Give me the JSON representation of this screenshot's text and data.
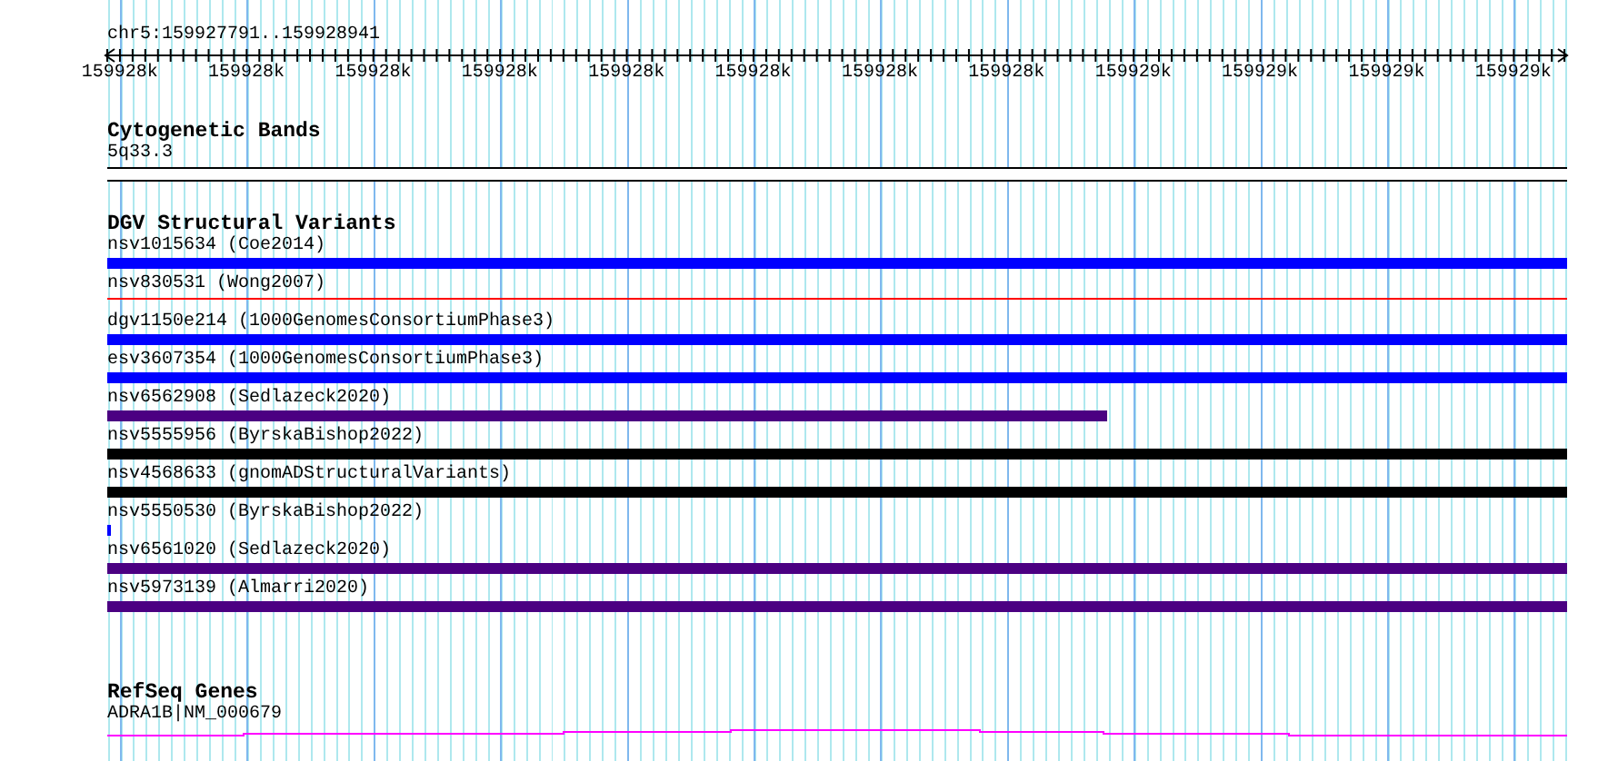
{
  "ruler": {
    "location": "chr5:159927791..159928941",
    "ticks": [
      "159928k",
      "159928k",
      "159928k",
      "159928k",
      "159928k",
      "159928k",
      "159928k",
      "159928k",
      "159929k",
      "159929k",
      "159929k",
      "159929k"
    ]
  },
  "tracks": [
    {
      "kind": "bands",
      "title": "Cytogenetic Bands",
      "features": [
        {
          "label": "5q33.3",
          "level": 1,
          "color": "#ffffff"
        }
      ]
    },
    {
      "kind": "variants",
      "title": "DGV Structural Variants",
      "features": [
        {
          "label": "nsv1015634 (Coe2014)",
          "kind": "bar",
          "level": 1,
          "color": "#0000ff"
        },
        {
          "label": "nsv830531 (Wong2007)",
          "kind": "line",
          "level": 1,
          "color": "#ff0000"
        },
        {
          "label": "dgv1150e214 (1000GenomesConsortiumPhase3)",
          "kind": "bar",
          "level": 1,
          "color": "#0000ff"
        },
        {
          "label": "esv3607354 (1000GenomesConsortiumPhase3)",
          "kind": "bar",
          "level": 1,
          "color": "#0000ff"
        },
        {
          "label": "nsv6562908 (Sedlazeck2020)",
          "kind": "bar",
          "level": 0.685,
          "color": "#4b0082"
        },
        {
          "label": "nsv5555956 (ByrskaBishop2022)",
          "kind": "bar",
          "level": 1,
          "color": "#000000"
        },
        {
          "label": "nsv4568633 (gnomADStructuralVariants)",
          "kind": "bar",
          "level": 1,
          "color": "#000000"
        },
        {
          "label": "nsv5550530 (ByrskaBishop2022)",
          "kind": "bar",
          "level": 0.003,
          "color": "#0000ff"
        },
        {
          "label": "nsv6561020 (Sedlazeck2020)",
          "kind": "bar",
          "level": 1,
          "color": "#4b0082"
        },
        {
          "label": "nsv5973139 (Almarri2020)",
          "kind": "bar",
          "level": 1,
          "color": "#4b0082"
        }
      ]
    },
    {
      "kind": "genes",
      "title": "RefSeq Genes",
      "features": [
        {
          "label": "ADRA1B|NM_000679",
          "color": "#ff00ff"
        }
      ]
    }
  ]
}
